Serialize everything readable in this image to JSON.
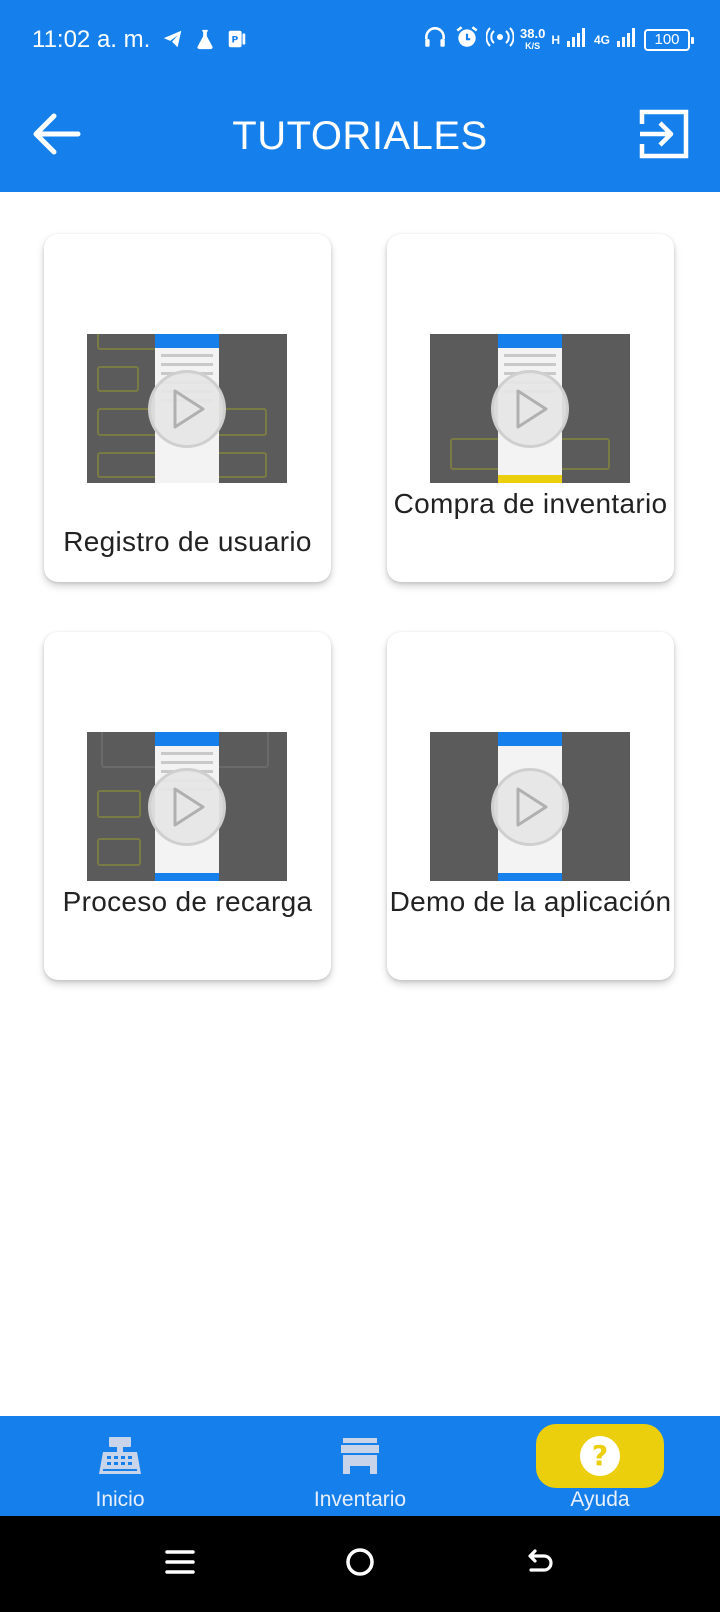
{
  "status_bar": {
    "time": "11:02 a. m.",
    "speed_value": "38.0",
    "speed_unit": "K/S",
    "network_1": "H",
    "network_2": "4G",
    "battery": "100"
  },
  "app_bar": {
    "title": "TUTORIALES",
    "back_icon": "arrow-left-icon",
    "exit_icon": "logout-icon"
  },
  "tutorials": [
    {
      "label": "Registro de usuario"
    },
    {
      "label": "Compra de inventario"
    },
    {
      "label": "Proceso de recarga"
    },
    {
      "label": "Demo de la aplicación"
    }
  ],
  "bottom_nav": {
    "items": [
      {
        "label": "Inicio",
        "icon": "cash-register-icon"
      },
      {
        "label": "Inventario",
        "icon": "store-icon"
      },
      {
        "label": "Ayuda",
        "icon": "help-icon",
        "active": true
      }
    ]
  },
  "colors": {
    "primary": "#1580EB",
    "accent": "#EBCF0D"
  }
}
